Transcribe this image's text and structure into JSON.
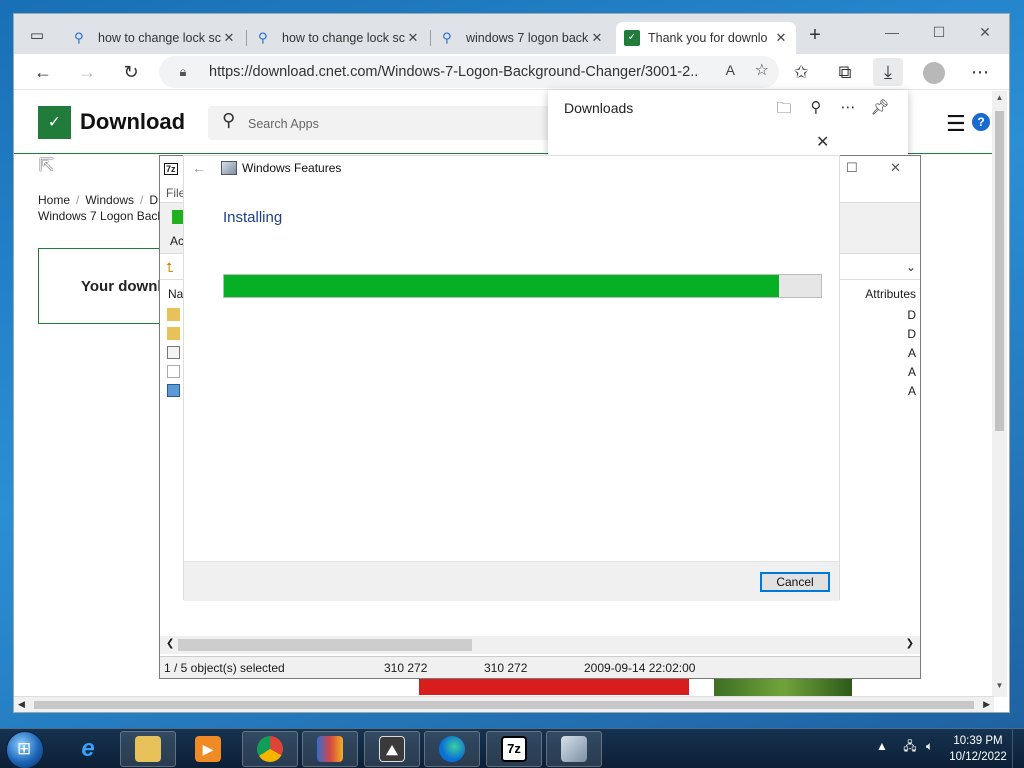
{
  "browser": {
    "tabs": [
      {
        "title": "how to change lock sc",
        "icon": "search-icon"
      },
      {
        "title": "how to change lock sc",
        "icon": "search-icon"
      },
      {
        "title": "windows 7 logon back",
        "icon": "search-icon"
      },
      {
        "title": "Thank you for downlo",
        "icon": "cnet-icon",
        "active": true
      }
    ],
    "address": "https://download.cnet.com/Windows-7-Logon-Background-Changer/3001-2..."
  },
  "page": {
    "logo_letter": "✓",
    "brand": "Download",
    "search_placeholder": "Search Apps",
    "breadcrumb": [
      "Home",
      "Windows",
      "D"
    ],
    "breadcrumb_line2": "Windows 7 Logon Back",
    "download_box": "Your downl"
  },
  "downloads_panel": {
    "title": "Downloads"
  },
  "zip": {
    "menu": "File",
    "toolbar_label": "Ac",
    "col_name": "Na",
    "col_attr": "Attributes",
    "rows": [
      {
        "attr": "D",
        "type": "folder"
      },
      {
        "attr": "D",
        "type": "folder"
      },
      {
        "attr": "A",
        "type": "text"
      },
      {
        "attr": "A",
        "type": "file"
      },
      {
        "attr": "A",
        "type": "app"
      }
    ],
    "status": {
      "selected": "1 / 5 object(s) selected",
      "size": "310 272",
      "packed": "310 272",
      "modified": "2009-09-14 22:02:00"
    }
  },
  "dialog": {
    "title": "Windows Features",
    "heading": "Installing",
    "progress": 0.93,
    "cancel": "Cancel"
  },
  "taskbar": {
    "time": "10:39 PM",
    "date": "10/12/2022",
    "zip_label": "7z"
  }
}
